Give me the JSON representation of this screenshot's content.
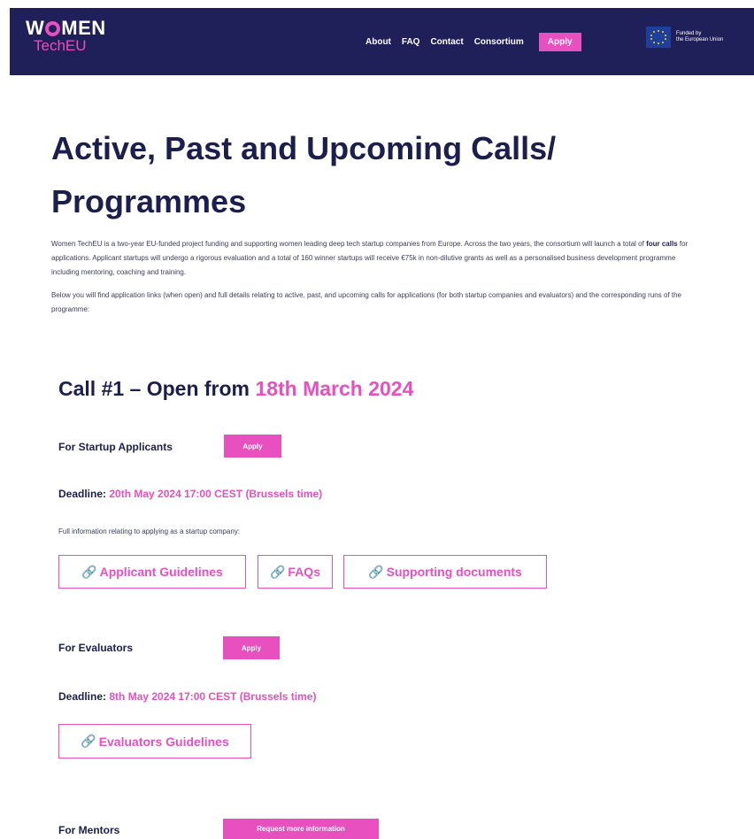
{
  "header": {
    "logo_top": "WMEN",
    "logo_top_prefix": "W",
    "logo_top_suffix": "MEN",
    "logo_bottom": "TechEU",
    "nav": [
      "About",
      "FAQ",
      "Contact",
      "Consortium"
    ],
    "apply_label": "Apply",
    "eu_line1": "Funded by",
    "eu_line2": "the European Union"
  },
  "page": {
    "title_line1": "Active, Past and Upcoming Calls/",
    "title_line2": "Programmes",
    "intro_part1": "Women TechEU is a two-year EU-funded project funding and supporting women leading deep tech startup companies from Europe. Across the two years, the consortium will launch a total of ",
    "intro_bold": "four calls",
    "intro_part2": " for applications. Applicant startups will undergo a rigorous evaluation and a total of 160 winner startups will receive €75k in non-dilutive grants as well as a personalised business development programme including mentoring, coaching and training.",
    "intro2": "Below you will find application links (when open) and full details relating to active, past, and upcoming calls for applications (for both startup companies and evaluators) and the corresponding runs of the programme:"
  },
  "call": {
    "title_prefix": "Call #1 – Open from ",
    "title_date": "18th March 2024",
    "startup": {
      "label": "For Startup Applicants",
      "button": "Apply",
      "deadline_label": "Deadline: ",
      "deadline_value": "20th May 2024 17:00 CEST (Brussels time)",
      "note": "Full information relating to applying as a startup company:",
      "links": [
        "Applicant Guidelines",
        "FAQs",
        "Supporting documents"
      ]
    },
    "evaluators": {
      "label": "For Evaluators",
      "button": "Apply",
      "deadline_label": "Deadline: ",
      "deadline_value": "8th May 2024 17:00 CEST (Brussels time)",
      "links": [
        "Evaluators Guidelines"
      ]
    },
    "mentors": {
      "label": "For Mentors",
      "button": "Request more information"
    }
  },
  "icons": {
    "link": "link-icon"
  },
  "colors": {
    "navy": "#1f1f5a",
    "pink": "#e84fbf",
    "text": "#1c1f4d"
  }
}
